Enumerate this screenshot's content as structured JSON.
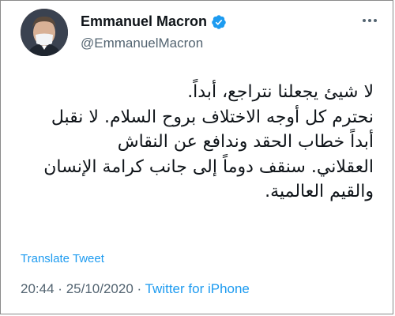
{
  "author": {
    "name": "Emmanuel Macron",
    "handle": "@EmmanuelMacron",
    "verified": true,
    "avatar_icon": "profile-photo"
  },
  "tweet": {
    "lines": [
      "لا شيئ يجعلنا نتراجع، أبداً.",
      "نحترم كل أوجه الاختلاف بروح السلام. لا نقبل",
      "أبداً خطاب الحقد وندافع عن النقاش",
      "العقلاني. سنقف دوماً إلى جانب كرامة الإنسان",
      "والقيم العالمية."
    ],
    "translate_label": "Translate Tweet",
    "time": "20:44",
    "separator": "·",
    "date": "25/10/2020",
    "source": "Twitter for iPhone"
  },
  "colors": {
    "link": "#1d9bf0",
    "muted": "#536471",
    "text": "#0f1419",
    "verified_badge": "#1d9bf0"
  }
}
